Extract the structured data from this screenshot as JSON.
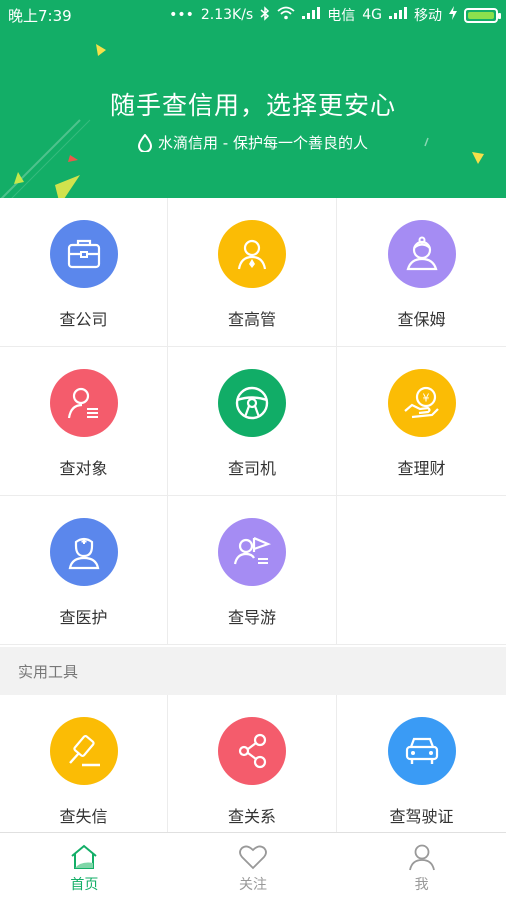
{
  "status_bar": {
    "time": "晚上7:39",
    "dots": "•••",
    "speed": "2.13K/s",
    "carrier1": "电信",
    "network": "4G",
    "carrier2": "移动"
  },
  "banner": {
    "title": "随手查信用，选择更安心",
    "subtitle": "水滴信用 - 保护每一个善良的人"
  },
  "colors": {
    "brand": "#13ae67",
    "blue": "#5b87ec",
    "yellow": "#fbbc05",
    "purple": "#a58cf3",
    "red": "#f45c6c",
    "green": "#11ad67",
    "skyblue": "#3a9bf5"
  },
  "categories": [
    {
      "label": "查公司",
      "icon": "briefcase-icon"
    },
    {
      "label": "查高管",
      "icon": "executive-icon"
    },
    {
      "label": "查保姆",
      "icon": "nanny-icon"
    },
    {
      "label": "查对象",
      "icon": "partner-icon"
    },
    {
      "label": "查司机",
      "icon": "steering-wheel-icon"
    },
    {
      "label": "查理财",
      "icon": "finance-icon"
    },
    {
      "label": "查医护",
      "icon": "nurse-icon"
    },
    {
      "label": "查导游",
      "icon": "tour-guide-icon"
    }
  ],
  "tools_section": {
    "title": "实用工具",
    "items": [
      {
        "label": "查失信",
        "icon": "gavel-icon"
      },
      {
        "label": "查关系",
        "icon": "share-icon"
      },
      {
        "label": "查驾驶证",
        "icon": "car-icon"
      }
    ]
  },
  "bottom_nav": [
    {
      "label": "首页",
      "icon": "home-icon",
      "active": true
    },
    {
      "label": "关注",
      "icon": "heart-icon",
      "active": false
    },
    {
      "label": "我",
      "icon": "user-icon",
      "active": false
    }
  ]
}
